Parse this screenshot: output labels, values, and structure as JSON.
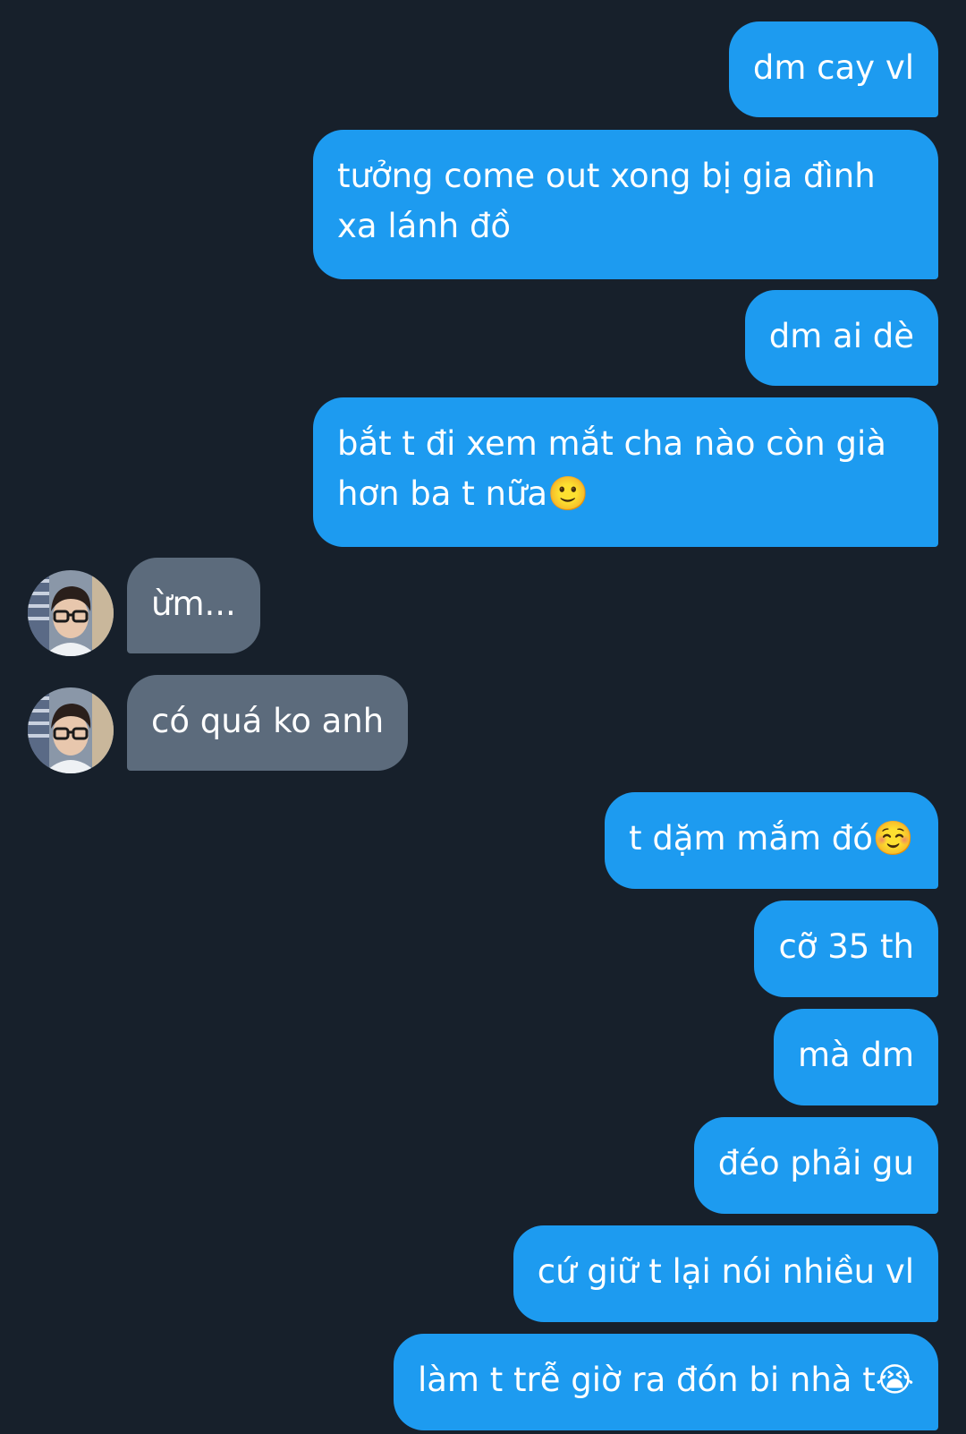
{
  "conversation": {
    "messages": [
      {
        "direction": "outgoing",
        "text": "dm cay vl"
      },
      {
        "direction": "outgoing",
        "text": "tưởng come out xong bị gia đình xa lánh đồ"
      },
      {
        "direction": "outgoing",
        "text": "dm ai dè"
      },
      {
        "direction": "outgoing",
        "text": "bắt t đi xem mắt cha nào còn già hơn ba t nữa🙂"
      },
      {
        "direction": "incoming",
        "text": "ừm..."
      },
      {
        "direction": "incoming",
        "text": "có quá ko anh"
      },
      {
        "direction": "outgoing",
        "text": "t dặm mắm đó☺️"
      },
      {
        "direction": "outgoing",
        "text": "cỡ 35 th"
      },
      {
        "direction": "outgoing",
        "text": "mà dm"
      },
      {
        "direction": "outgoing",
        "text": "đéo phải gu"
      },
      {
        "direction": "outgoing",
        "text": "cứ giữ t lại nói nhiều vl"
      },
      {
        "direction": "outgoing",
        "text": "làm t trễ giờ ra đón bi nhà t😭"
      }
    ]
  },
  "theme": {
    "background": "#17202b",
    "outgoing_bubble": "#1d9bf0",
    "incoming_bubble": "#5c6b7c",
    "text": "#ffffff"
  }
}
